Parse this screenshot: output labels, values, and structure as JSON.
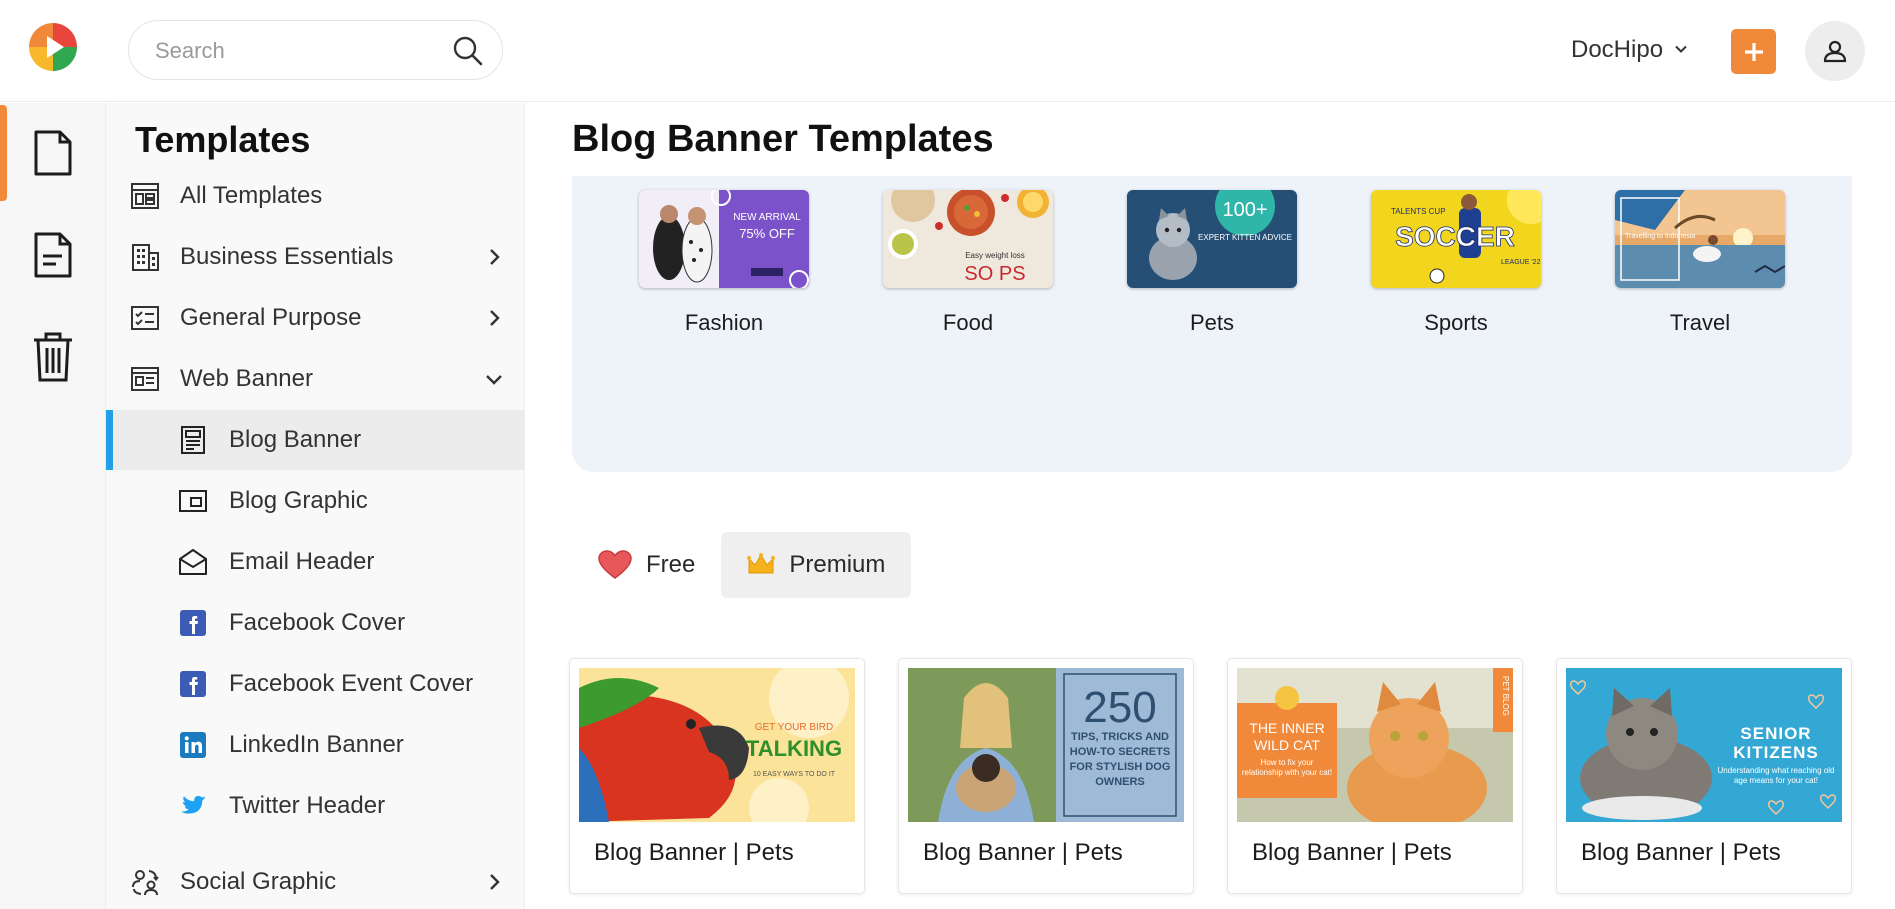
{
  "header": {
    "search": {
      "placeholder": "Search"
    },
    "brand": {
      "label": "DocHipo"
    },
    "accent": "#f0893a"
  },
  "rail": {
    "items": [
      {
        "icon": "document-icon",
        "active": true
      },
      {
        "icon": "text-document-icon",
        "active": false
      },
      {
        "icon": "trash-icon",
        "active": false
      }
    ]
  },
  "sidebar": {
    "title": "Templates",
    "items": [
      {
        "label": "All Templates",
        "icon": "layout-grid-icon"
      },
      {
        "label": "Business Essentials",
        "icon": "building-icon",
        "chevron": "right"
      },
      {
        "label": "General Purpose",
        "icon": "checklist-card-icon",
        "chevron": "right"
      },
      {
        "label": "Web Banner",
        "icon": "web-banner-icon",
        "chevron": "down"
      },
      {
        "label": "Blog Banner",
        "icon": "blog-banner-icon",
        "selected": true
      },
      {
        "label": "Blog Graphic",
        "icon": "blog-graphic-icon"
      },
      {
        "label": "Email Header",
        "icon": "envelope-open-icon"
      },
      {
        "label": "Facebook Cover",
        "icon": "facebook-icon"
      },
      {
        "label": "Facebook Event Cover",
        "icon": "facebook-icon"
      },
      {
        "label": "LinkedIn Banner",
        "icon": "linkedin-icon"
      },
      {
        "label": "Twitter Header",
        "icon": "twitter-icon"
      },
      {
        "label": "Social Graphic",
        "icon": "social-people-icon",
        "chevron": "right"
      }
    ],
    "selected_color": "#21a0e6"
  },
  "main": {
    "title": "Blog Banner Templates",
    "categories": [
      {
        "name": "Fashion",
        "thumb": {
          "line1": "NEW ARRIVAL",
          "line2": "75% OFF"
        }
      },
      {
        "name": "Food",
        "thumb": {
          "line1": "Easy weight loss",
          "line2": "SO PS"
        }
      },
      {
        "name": "Pets",
        "thumb": {
          "line1": "100+",
          "line2": "EXPERT KITTEN ADVICE"
        }
      },
      {
        "name": "Sports",
        "thumb": {
          "line1": "TALENTS CUP",
          "line2": "SOCCER",
          "line3": "LEAGUE '22"
        }
      },
      {
        "name": "Travel",
        "thumb": {
          "line1": "Travelling to Indonesia"
        }
      }
    ],
    "filters": [
      {
        "label": "Free",
        "icon": "heart-icon",
        "active": false
      },
      {
        "label": "Premium",
        "icon": "crown-icon",
        "active": true
      }
    ],
    "templates": [
      {
        "caption": "Blog Banner | Pets",
        "thumb": {
          "line1": "GET YOUR BIRD",
          "line2": "TALKING",
          "line3": "10 EASY WAYS TO DO IT"
        }
      },
      {
        "caption": "Blog Banner | Pets",
        "thumb": {
          "line1": "250",
          "line2": "TIPS, TRICKS AND HOW-TO SECRETS FOR STYLISH DOG OWNERS"
        }
      },
      {
        "caption": "Blog Banner | Pets",
        "thumb": {
          "line1": "THE INNER WILD CAT",
          "line2": "How to fix your relationship with your cat!",
          "line3": "PET BLOG"
        }
      },
      {
        "caption": "Blog Banner | Pets",
        "thumb": {
          "line1": "SENIOR KITIZENS",
          "line2": "Understanding what reaching old age means for your cat!"
        }
      }
    ]
  }
}
